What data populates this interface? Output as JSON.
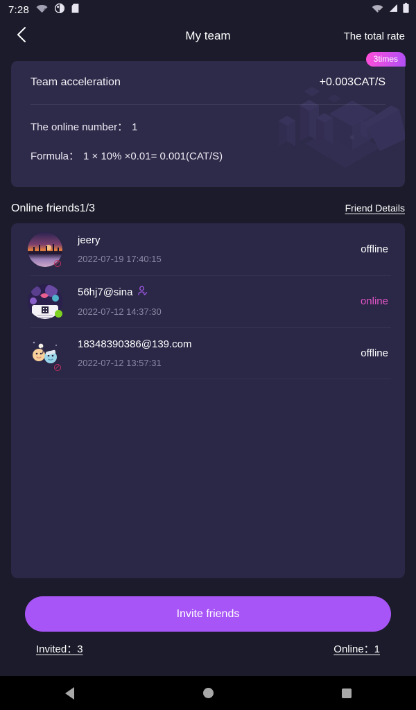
{
  "statusbar": {
    "time": "7:28",
    "left_icons": [
      "wifi-question-icon",
      "theme-circle-icon",
      "sd-card-icon"
    ],
    "right_icons": [
      "wifi-off-icon",
      "cellular-signal-icon",
      "battery-icon"
    ]
  },
  "header": {
    "back_icon": "chevron-left-icon",
    "title": "My team",
    "right_label": "The total rate"
  },
  "acceleration_card": {
    "badge": "3times",
    "label": "Team acceleration",
    "value": "+0.003CAT/S",
    "online_number_label": "The online number：",
    "online_number_value": "1",
    "formula_label": "Formula：",
    "formula_value": "1 × 10% ×0.01= 0.001(CAT/S)"
  },
  "friends_section": {
    "title": "Online friends1/3",
    "details_link": "Friend Details",
    "rows": [
      {
        "name": "jeery",
        "time": "2022-07-19 17:40:15",
        "status": "offline",
        "verified": false,
        "avatar": "sunset-photo-avatar",
        "presence_dot": "offline-dot"
      },
      {
        "name": "56hj7@sina",
        "time": "2022-07-12 14:37:30",
        "status": "online",
        "verified": true,
        "avatar": "qr-card-illustration-avatar",
        "presence_dot": "online-dot"
      },
      {
        "name": "18348390386@139.com",
        "time": "2022-07-12 13:57:31",
        "status": "offline",
        "verified": false,
        "avatar": "cartoon-characters-avatar",
        "presence_dot": "offline-dot"
      }
    ]
  },
  "bottom": {
    "invite_button": "Invite friends",
    "invited_stat": "Invited：3",
    "online_stat": "Online：1"
  },
  "navbar": {
    "back": "back-triangle-icon",
    "home": "home-circle-icon",
    "recents": "recents-square-icon"
  },
  "colors": {
    "page_bg": "#1b1b2b",
    "card_bg": "#2e2a49",
    "panel_bg": "#2a2747",
    "accent_purple": "#a855f7",
    "accent_pink": "#e455c8",
    "online_green": "#7ed321",
    "muted_text": "#8c88a4"
  }
}
